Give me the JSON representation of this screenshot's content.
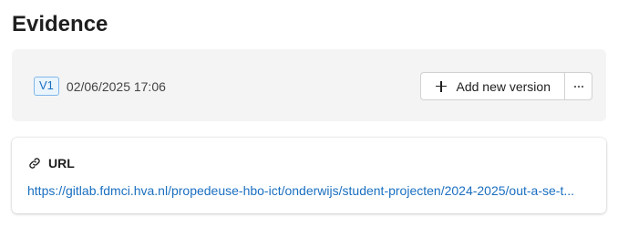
{
  "section": {
    "title": "Evidence"
  },
  "version": {
    "badge": "V1",
    "date": "02/06/2025 17:06",
    "add_button_label": "Add new version",
    "more_label": "···"
  },
  "evidence_item": {
    "type_label": "URL",
    "url": "https://gitlab.fdmci.hva.nl/propedeuse-hbo-ict/onderwijs/student-projecten/2024-2025/out-a-se-t..."
  },
  "icons": {
    "add": "plus-icon",
    "more": "more-icon",
    "link": "link-icon"
  },
  "colors": {
    "accent": "#1a6fc0",
    "badge_border": "#7fb7ea",
    "badge_bg": "#eaf4fd",
    "panel_bg": "#f4f4f4"
  }
}
